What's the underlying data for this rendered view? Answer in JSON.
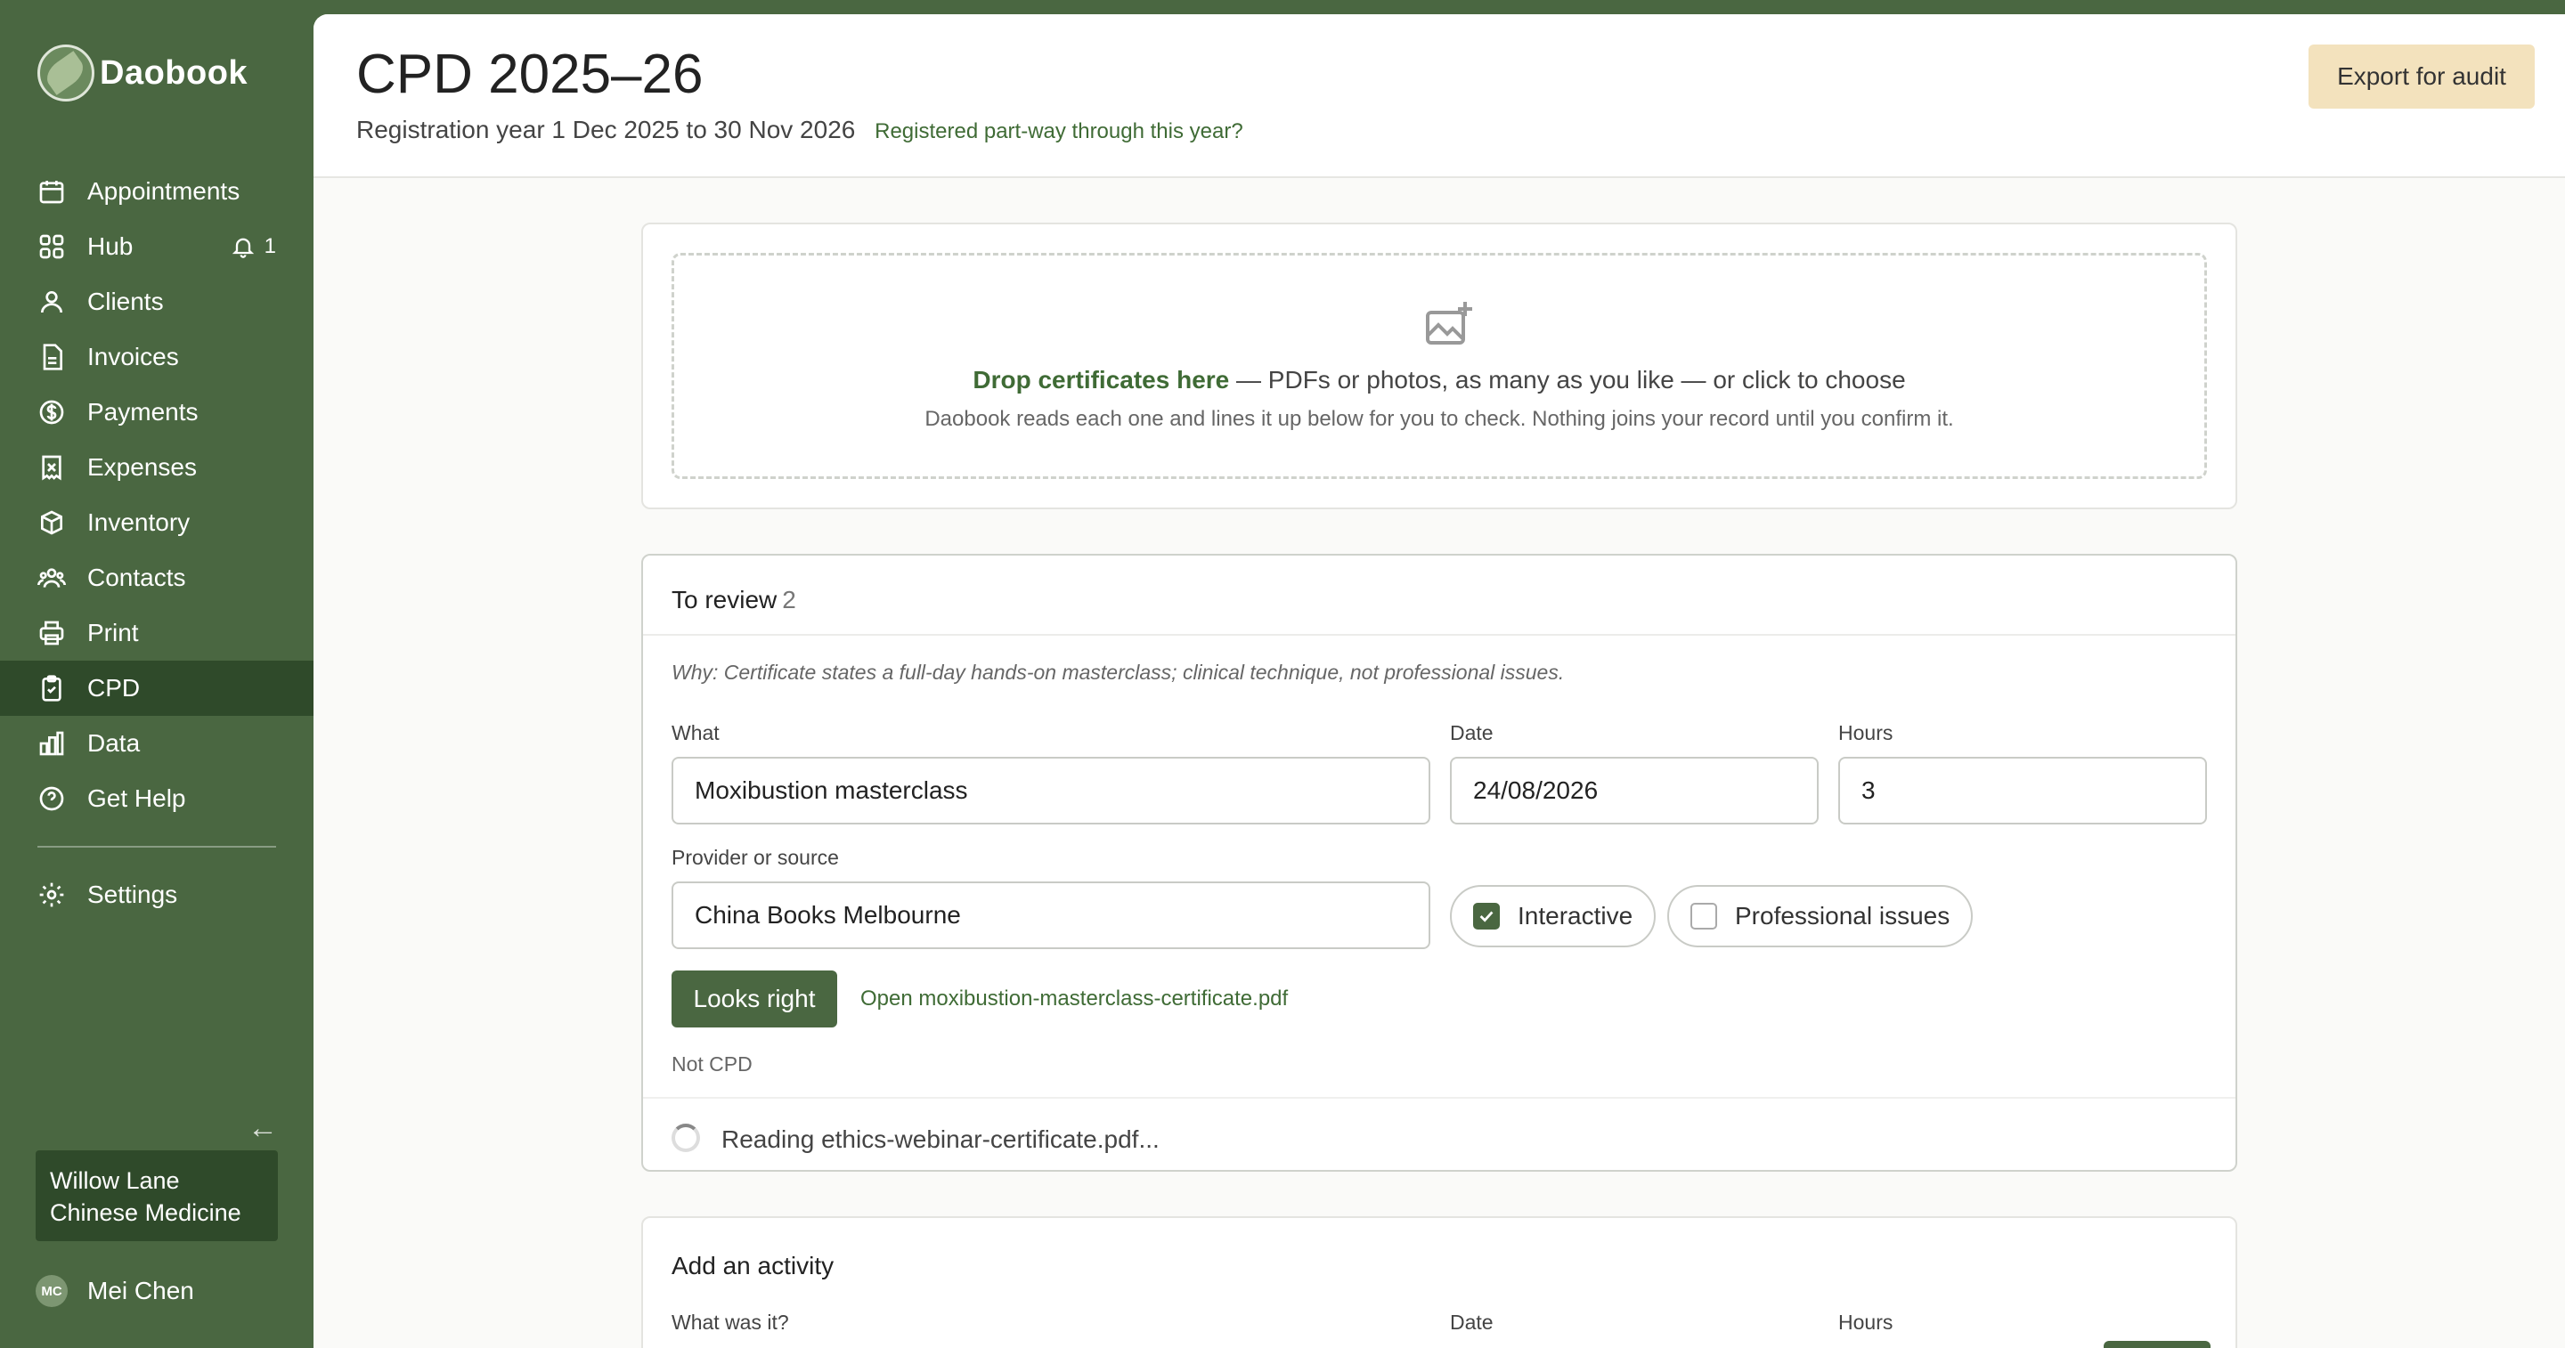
{
  "brand": {
    "name": "Daobook"
  },
  "sidebar": {
    "items": [
      {
        "label": "Appointments",
        "icon": "calendar-icon"
      },
      {
        "label": "Hub",
        "icon": "grid-icon",
        "badge": "1"
      },
      {
        "label": "Clients",
        "icon": "users-icon"
      },
      {
        "label": "Invoices",
        "icon": "document-icon"
      },
      {
        "label": "Payments",
        "icon": "dollar-icon"
      },
      {
        "label": "Expenses",
        "icon": "receipt-icon"
      },
      {
        "label": "Inventory",
        "icon": "box-icon"
      },
      {
        "label": "Contacts",
        "icon": "contacts-icon"
      },
      {
        "label": "Print",
        "icon": "printer-icon"
      },
      {
        "label": "CPD",
        "icon": "clipboard-icon",
        "active": true
      },
      {
        "label": "Data",
        "icon": "bar-chart-icon"
      },
      {
        "label": "Get Help",
        "icon": "help-icon"
      }
    ],
    "settings_label": "Settings",
    "org_name": "Willow Lane Chinese Medicine",
    "user_initials": "MC",
    "user_name": "Mei Chen"
  },
  "header": {
    "title": "CPD 2025–26",
    "subtitle": "Registration year 1 Dec 2025 to 30 Nov 2026",
    "subtitle_link": "Registered part-way through this year?",
    "export_label": "Export for audit"
  },
  "upload": {
    "main_em": "Drop certificates here",
    "main_rest": " — PDFs or photos, as many as you like — or click to choose",
    "sub": "Daobook reads each one and lines it up below for you to check. Nothing joins your record until you confirm it."
  },
  "review": {
    "title": "To review",
    "count": "2",
    "why": "Why: Certificate states a full-day hands-on masterclass; clinical technique, not professional issues.",
    "what_label": "What",
    "what_value": "Moxibustion masterclass",
    "date_label": "Date",
    "date_value": "24/08/2026",
    "hours_label": "Hours",
    "hours_value": "3",
    "provider_label": "Provider or source",
    "provider_value": "China Books Melbourne",
    "interactive_label": "Interactive",
    "interactive_checked": true,
    "professional_label": "Professional issues",
    "professional_checked": false,
    "confirm_label": "Looks right",
    "open_link": "Open moxibustion-masterclass-certificate.pdf",
    "not_cpd": "Not CPD",
    "reading": "Reading ethics-webinar-certificate.pdf..."
  },
  "add": {
    "title": "Add an activity",
    "what_label": "What was it?",
    "date_label": "Date",
    "hours_label": "Hours"
  }
}
